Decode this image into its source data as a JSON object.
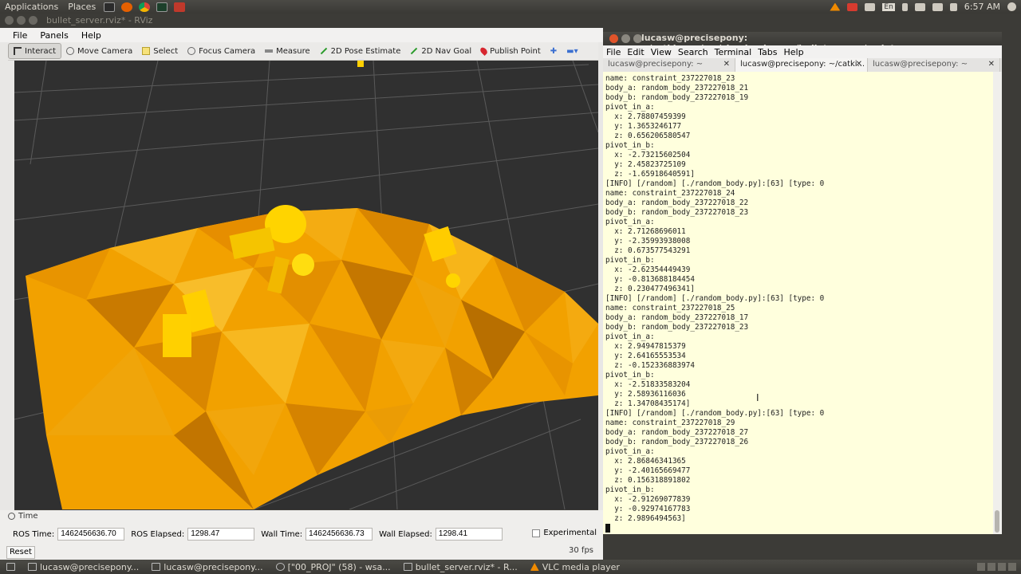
{
  "top_panel": {
    "menus": [
      "Applications",
      "Places"
    ],
    "tray": {
      "lang": "En",
      "clock": "6:57 AM"
    }
  },
  "rviz": {
    "title": "bullet_server.rviz* - RViz",
    "menu": [
      "File",
      "Panels",
      "Help"
    ],
    "tools": [
      "Interact",
      "Move Camera",
      "Select",
      "Focus Camera",
      "Measure",
      "2D Pose Estimate",
      "2D Nav Goal",
      "Publish Point"
    ],
    "time_panel": {
      "header": "Time",
      "ros_time_label": "ROS Time:",
      "ros_time": "1462456636.70",
      "ros_elapsed_label": "ROS Elapsed:",
      "ros_elapsed": "1298.47",
      "wall_time_label": "Wall Time:",
      "wall_time": "1462456636.73",
      "wall_elapsed_label": "Wall Elapsed:",
      "wall_elapsed": "1298.41",
      "experimental": "Experimental",
      "reset": "Reset",
      "fps": "30 fps"
    },
    "colors": {
      "terrain": "#f4a300",
      "bodies": "#ffd000",
      "background": "#303030"
    }
  },
  "terminal": {
    "title": "lucasw@precisepony: ~/catkin_ws/src/simple_sim_ros/bullet_server/scripts",
    "menu": [
      "File",
      "Edit",
      "View",
      "Search",
      "Terminal",
      "Tabs",
      "Help"
    ],
    "tabs": [
      "lucasw@precisepony: ~",
      "lucasw@precisepony: ~/catki...",
      "lucasw@precisepony: ~"
    ],
    "lines": [
      "name: constraint_237227018_23",
      "body_a: random_body_237227018_21",
      "body_b: random_body_237227018_19",
      "pivot_in_a:",
      "  x: 2.78807459399",
      "  y: 1.3653246177",
      "  z: 0.656206580547",
      "pivot_in_b:",
      "  x: -2.73215602504",
      "  y: 2.45823725109",
      "  z: -1.65918640591]",
      "[INFO] [/random] [./random_body.py]:[63] [type: 0",
      "name: constraint_237227018_24",
      "body_a: random_body_237227018_22",
      "body_b: random_body_237227018_23",
      "pivot_in_a:",
      "  x: 2.71268696011",
      "  y: -2.35993938008",
      "  z: 0.673577543291",
      "pivot_in_b:",
      "  x: -2.62354449439",
      "  y: -0.813688184454",
      "  z: 0.230477496341]",
      "[INFO] [/random] [./random_body.py]:[63] [type: 0",
      "name: constraint_237227018_25",
      "body_a: random_body_237227018_17",
      "body_b: random_body_237227018_23",
      "pivot_in_a:",
      "  x: 2.94947815379",
      "  y: 2.64165553534",
      "  z: -0.152336883974",
      "pivot_in_b:",
      "  x: -2.51833583204",
      "  y: 2.58936116036",
      "  z: 1.34708435174]",
      "[INFO] [/random] [./random_body.py]:[63] [type: 0",
      "name: constraint_237227018_29",
      "body_a: random_body_237227018_27",
      "body_b: random_body_237227018_26",
      "pivot_in_a:",
      "  x: 2.86846341365",
      "  y: -2.40165669477",
      "  z: 0.156318891802",
      "pivot_in_b:",
      "  x: -2.91269077839",
      "  y: -0.92974167783",
      "  z: 2.9896494563]"
    ]
  },
  "taskbar": {
    "items": [
      "lucasw@precisepony...",
      "lucasw@precisepony...",
      "[\"00_PROJ\" (58) - wsa...",
      "bullet_server.rviz* - R...",
      "VLC media player"
    ]
  }
}
